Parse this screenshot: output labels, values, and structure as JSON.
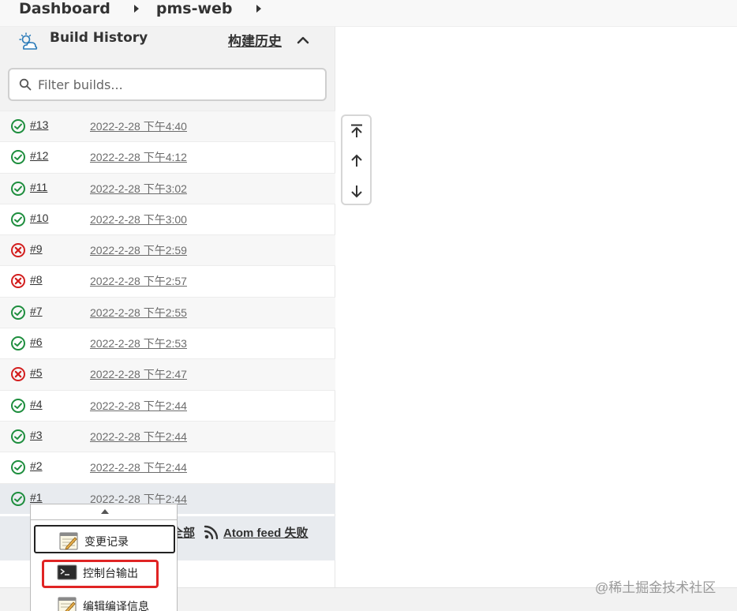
{
  "breadcrumb": {
    "items": [
      "Dashboard",
      "pms-web"
    ]
  },
  "panel": {
    "title": "Build History",
    "trend_label": "构建历史",
    "filter_placeholder": "Filter builds..."
  },
  "builds": [
    {
      "number": "#13",
      "date": "2022-2-28 下午4:40",
      "status": "success"
    },
    {
      "number": "#12",
      "date": "2022-2-28 下午4:12",
      "status": "success"
    },
    {
      "number": "#11",
      "date": "2022-2-28 下午3:02",
      "status": "success"
    },
    {
      "number": "#10",
      "date": "2022-2-28 下午3:00",
      "status": "success"
    },
    {
      "number": "#9",
      "date": "2022-2-28 下午2:59",
      "status": "failed"
    },
    {
      "number": "#8",
      "date": "2022-2-28 下午2:57",
      "status": "failed"
    },
    {
      "number": "#7",
      "date": "2022-2-28 下午2:55",
      "status": "success"
    },
    {
      "number": "#6",
      "date": "2022-2-28 下午2:53",
      "status": "success"
    },
    {
      "number": "#5",
      "date": "2022-2-28 下午2:47",
      "status": "failed"
    },
    {
      "number": "#4",
      "date": "2022-2-28 下午2:44",
      "status": "success"
    },
    {
      "number": "#3",
      "date": "2022-2-28 下午2:44",
      "status": "success"
    },
    {
      "number": "#2",
      "date": "2022-2-28 下午2:44",
      "status": "success"
    },
    {
      "number": "#1",
      "date": "2022-2-28 下午2:44",
      "status": "success"
    }
  ],
  "footer": {
    "all_label": "全部",
    "atom_label": "Atom feed 失败"
  },
  "context_menu": {
    "items": [
      {
        "label": "变更记录",
        "icon": "notepad-icon"
      },
      {
        "label": "控制台输出",
        "icon": "terminal-icon"
      },
      {
        "label": "编辑编译信息",
        "icon": "notepad-icon"
      }
    ]
  },
  "watermark": "@稀土掘金技术社区",
  "colors": {
    "success": "#1e8e3e",
    "failed": "#d31f1f",
    "highlight": "#e02424"
  }
}
